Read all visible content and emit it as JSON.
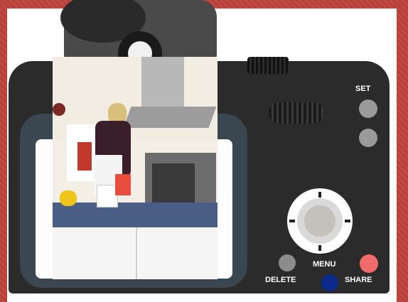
{
  "camera": {
    "labels": {
      "set": "SET",
      "menu": "MENU",
      "delete": "DELETE",
      "share": "SHARE"
    },
    "colors": {
      "frame": "#b8433d",
      "body": "#2b2b2b",
      "share_button": "#f06b6b",
      "menu_button": "#0b2a8a",
      "delete_button": "#8c8c8c"
    }
  }
}
